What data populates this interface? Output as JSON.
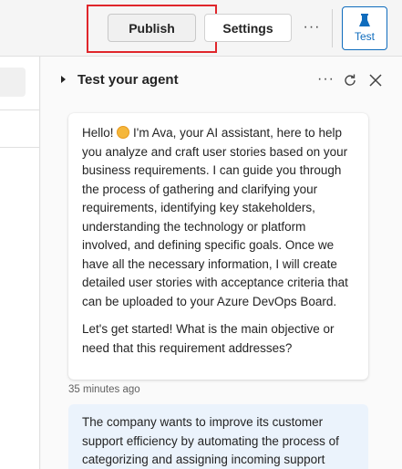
{
  "toolbar": {
    "publish_label": "Publish",
    "settings_label": "Settings",
    "more_label": "···",
    "test_label": "Test"
  },
  "panel": {
    "title": "Test your agent",
    "more_label": "···"
  },
  "messages": {
    "bot_paragraph_1_pre": "Hello! ",
    "bot_paragraph_1_post": " I'm Ava, your AI assistant, here to help you analyze and craft user stories based on your business requirements. I can guide you through the process of gathering and clarifying your requirements, identifying key stakeholders, understanding the technology or platform involved, and defining specific goals. Once we have all the necessary information, I will create detailed user stories with acceptance criteria that can be uploaded to your Azure DevOps Board.",
    "bot_paragraph_2": "Let's get started! What is the main objective or need that this requirement addresses?",
    "bot_timestamp": "35 minutes ago",
    "user_text": "The company wants to improve its customer support efficiency by automating the process of categorizing and assigning incoming support"
  },
  "colors": {
    "accent": "#0f6cbd",
    "highlight": "#e0262b",
    "user_bubble": "#ebf3fc"
  }
}
